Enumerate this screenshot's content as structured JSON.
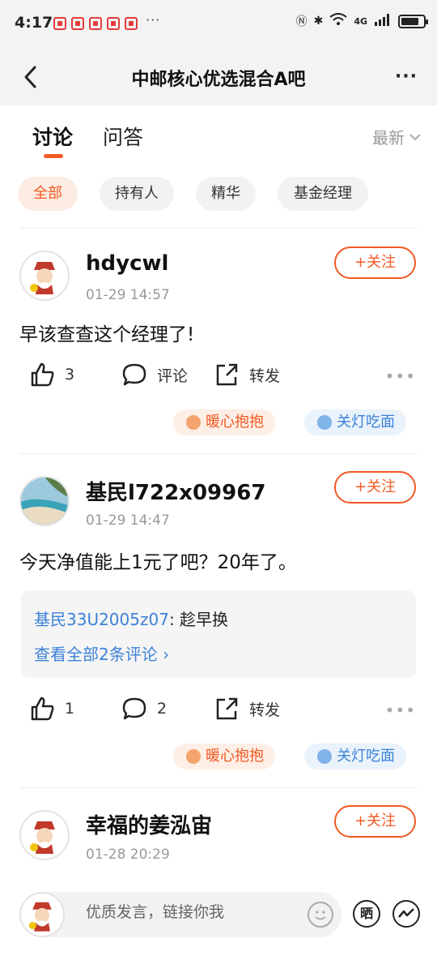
{
  "status_bar": {
    "time": "4:17",
    "overflow_dots": "···",
    "network": "4G",
    "battery_percent": 80
  },
  "header": {
    "title": "中邮核心优选混合A吧",
    "more": "···"
  },
  "tabs": {
    "active": "讨论",
    "inactive": "问答",
    "sort": "最新"
  },
  "filter_chips": [
    "全部",
    "持有人",
    "精华",
    "基金经理"
  ],
  "follow_label": "+关注",
  "reactions": {
    "warm": "暖心抱抱",
    "lamp": "关灯吃面"
  },
  "posts": [
    {
      "username": "hdycwl",
      "time": "01-29 14:57",
      "content": "早该查查这个经理了!",
      "likes": "3",
      "comments": "评论",
      "share": "转发"
    },
    {
      "username": "基民l722x09967",
      "time": "01-29 14:47",
      "content": "今天净值能上1元了吧？20年了。",
      "reply_user": "基民33U2005z07",
      "reply_text": ": 趁早换",
      "view_all": "查看全部2条评论 ›",
      "likes": "1",
      "comments": "2",
      "share": "转发"
    },
    {
      "username": "幸福的姜泓宙",
      "time": "01-28 20:29"
    }
  ],
  "bottom": {
    "placeholder": "优质发言，链接你我",
    "sun_icon_label": "晒"
  }
}
